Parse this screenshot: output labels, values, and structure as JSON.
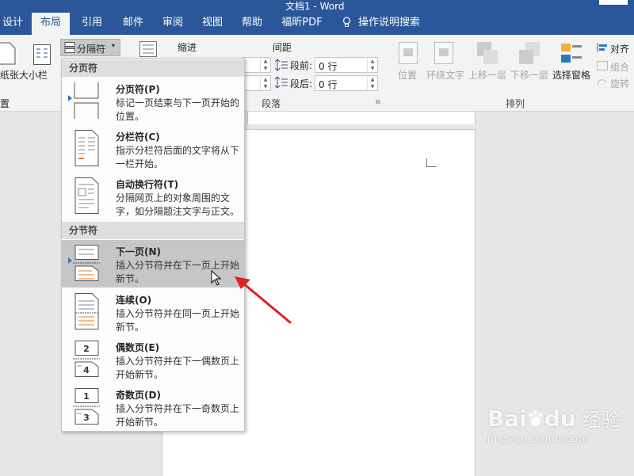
{
  "window": {
    "title_fragment": "文档1 - Word"
  },
  "tabs": [
    {
      "label": "设计",
      "active": false
    },
    {
      "label": "布局",
      "active": true
    },
    {
      "label": "引用",
      "active": false
    },
    {
      "label": "邮件",
      "active": false
    },
    {
      "label": "审阅",
      "active": false
    },
    {
      "label": "视图",
      "active": false
    },
    {
      "label": "帮助",
      "active": false
    },
    {
      "label": "福昕PDF",
      "active": false
    }
  ],
  "tell_me": "操作说明搜索",
  "ribbon": {
    "paper_size": "纸张大小",
    "columns": "栏",
    "breaks_button": "分隔符",
    "page_setup_group_fragment": "置",
    "indent_label": "缩进",
    "spacing_label": "间距",
    "before_label": "段前:",
    "before_value": "0 行",
    "after_label": "段后:",
    "after_value": "0 行",
    "paragraph_group": "段落",
    "position": "位置",
    "wrap_text": "环绕文字",
    "bring_forward": "上移一层",
    "send_backward": "下移一层",
    "selection_pane": "选择窗格",
    "align": "对齐",
    "group": "组合",
    "rotate": "旋转",
    "arrange_group": "排列"
  },
  "breaks_menu": {
    "page_breaks_header": "分页符",
    "section_breaks_header": "分节符",
    "items": [
      {
        "title": "分页符(P)",
        "desc": "标记一页结束与下一页开始的位置。"
      },
      {
        "title": "分栏符(C)",
        "desc": "指示分栏符后面的文字将从下一栏开始。"
      },
      {
        "title": "自动换行符(T)",
        "desc": "分隔网页上的对象周围的文字，如分隔题注文字与正文。"
      },
      {
        "title": "下一页(N)",
        "desc": "插入分节符并在下一页上开始新节。",
        "hover": true
      },
      {
        "title": "连续(O)",
        "desc": "插入分节符并在同一页上开始新节。"
      },
      {
        "title": "偶数页(E)",
        "desc": "插入分节符并在下一偶数页上开始新节。"
      },
      {
        "title": "奇数页(D)",
        "desc": "插入分节符并在下一奇数页上开始新节。"
      }
    ]
  },
  "watermark": {
    "brand": "Bai",
    "brand2": "du",
    "cn": "经验",
    "url": "jingyan.baidu.com"
  },
  "colors": {
    "ribbon_blue": "#2b579a",
    "hover": "#c6c6c6",
    "arrow": "#e02020",
    "accent": "#2b79c2"
  }
}
